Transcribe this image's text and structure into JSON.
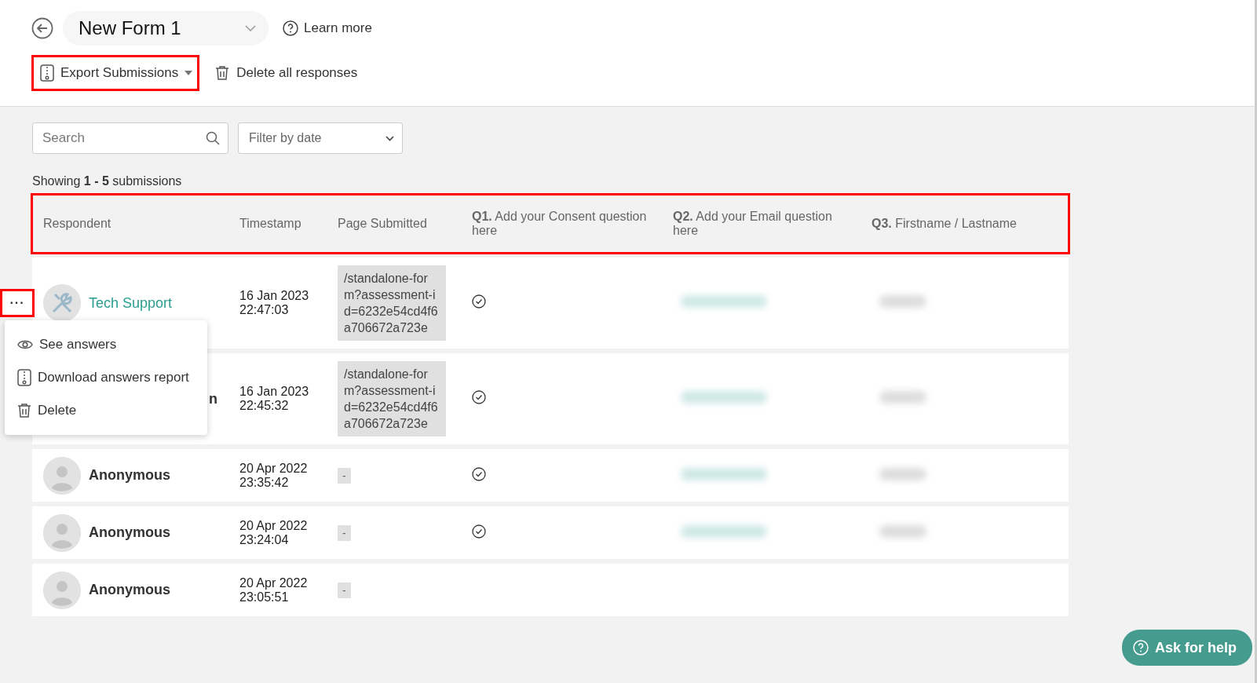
{
  "header": {
    "form_title": "New Form 1",
    "learn_more": "Learn more",
    "export_button": "Export Submissions",
    "delete_all": "Delete all responses"
  },
  "filters": {
    "search_placeholder": "Search",
    "date_filter": "Filter by date"
  },
  "summary": {
    "text": "Showing **1 - 5** submissions"
  },
  "table": {
    "columns": [
      {
        "label": "Respondent"
      },
      {
        "label": "Timestamp"
      },
      {
        "label": "Page Submitted"
      },
      {
        "prefix": "Q1.",
        "label": "Add your Consent question here"
      },
      {
        "prefix": "Q2.",
        "label": "Add your Email question here"
      },
      {
        "prefix": "Q3.",
        "label": "Firstname / Lastname"
      }
    ],
    "rows": [
      {
        "respondent": "Tech Support",
        "kind": "support",
        "date": "16 Jan 2023",
        "time": "22:47:03",
        "page": "/standalone-form?assessment-id=6232e54cd4f6a706672a723e",
        "consent": true,
        "email_blurred": true,
        "name_blurred": true,
        "menu_open": true
      },
      {
        "respondent": "n",
        "kind": "covered",
        "date": "16 Jan 2023",
        "time": "22:45:32",
        "page": "/standalone-form?assessment-id=6232e54cd4f6a706672a723e",
        "consent": true,
        "email_blurred": true,
        "name_blurred": true,
        "menu_open": false
      },
      {
        "respondent": "Anonymous",
        "kind": "anonymous",
        "date": "20 Apr 2022",
        "time": "23:35:42",
        "page": "-",
        "consent": true,
        "email_blurred": true,
        "name_blurred": true,
        "menu_open": false
      },
      {
        "respondent": "Anonymous",
        "kind": "anonymous",
        "date": "20 Apr 2022",
        "time": "23:24:04",
        "page": "-",
        "consent": true,
        "email_blurred": true,
        "name_blurred": true,
        "menu_open": false
      },
      {
        "respondent": "Anonymous",
        "kind": "anonymous",
        "date": "20 Apr 2022",
        "time": "23:05:51",
        "page": "-",
        "consent": false,
        "email_blurred": false,
        "name_blurred": false,
        "menu_open": false
      }
    ]
  },
  "row_menu": {
    "trigger": "···",
    "items": [
      {
        "label": "See answers"
      },
      {
        "label": "Download answers report"
      },
      {
        "label": "Delete"
      }
    ]
  },
  "help_button": "Ask for help"
}
